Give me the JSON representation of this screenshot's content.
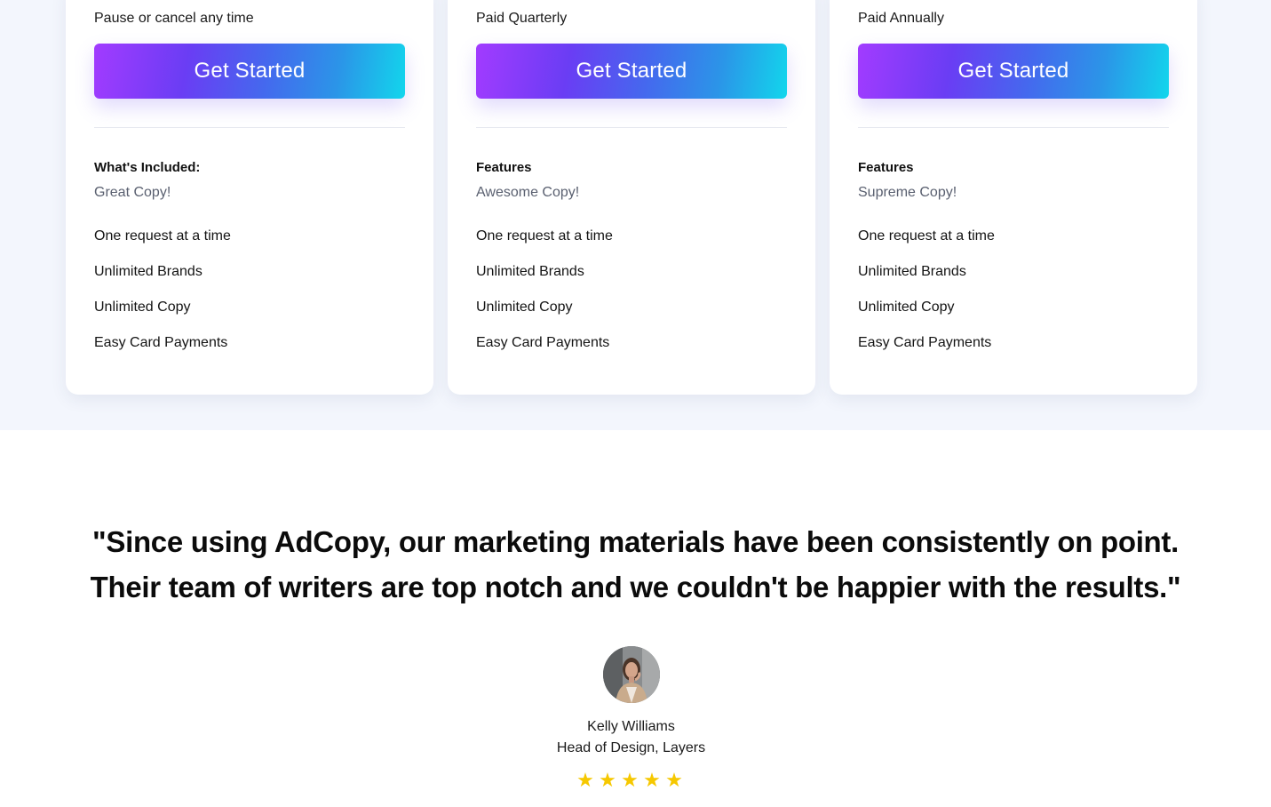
{
  "plans": [
    {
      "billing": "Pause or cancel any time",
      "cta_label": "Get Started",
      "section_title": "What's Included:",
      "tier_copy": "Great Copy!",
      "features": [
        "One request at a time",
        "Unlimited Brands",
        "Unlimited Copy",
        "Easy Card Payments"
      ]
    },
    {
      "billing": "Paid Quarterly",
      "cta_label": "Get Started",
      "section_title": "Features",
      "tier_copy": "Awesome Copy!",
      "features": [
        "One request at a time",
        "Unlimited Brands",
        "Unlimited Copy",
        "Easy Card Payments"
      ]
    },
    {
      "billing": "Paid Annually",
      "cta_label": "Get Started",
      "section_title": "Features",
      "tier_copy": "Supreme Copy!",
      "features": [
        "One request at a time",
        "Unlimited Brands",
        "Unlimited Copy",
        "Easy Card Payments"
      ]
    }
  ],
  "testimonial": {
    "quote_line1": "\"Since using AdCopy, our marketing materials have been consistently on point.",
    "quote_line2": "Their team of writers are top notch and we couldn't be happier with the results.\"",
    "author_name": "Kelly Williams",
    "author_role": "Head of Design, Layers",
    "rating": 5,
    "rating_max": 5,
    "star_glyph": "★"
  },
  "colors": {
    "band_background": "#f3f6fd",
    "cta_gradient_start": "#a23bff",
    "cta_gradient_end": "#12d6ec",
    "star": "#f6c800"
  }
}
